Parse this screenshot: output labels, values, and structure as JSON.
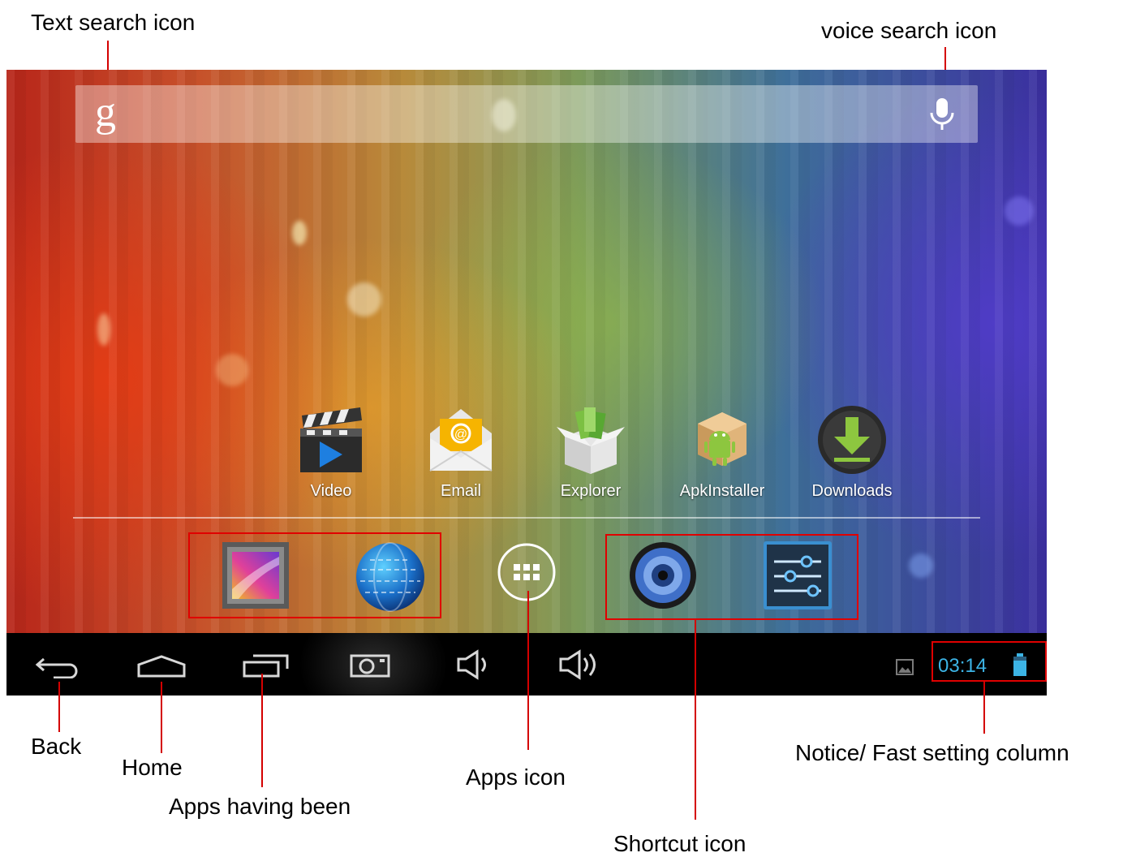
{
  "annotations": {
    "text_search": "Text search icon",
    "voice_search": "voice search icon",
    "back": "Back",
    "home": "Home",
    "recent_apps": "Apps  having  been",
    "apps": "Apps icon",
    "notice": "Notice/ Fast setting column",
    "shortcut": "Shortcut icon"
  },
  "search_bar": {
    "logo": "g"
  },
  "home_apps": [
    {
      "label": "Video",
      "icon": "video-clapper-icon"
    },
    {
      "label": "Email",
      "icon": "email-icon"
    },
    {
      "label": "Explorer",
      "icon": "explorer-box-icon"
    },
    {
      "label": "ApkInstaller",
      "icon": "apk-installer-icon"
    },
    {
      "label": "Downloads",
      "icon": "downloads-icon"
    }
  ],
  "dock": {
    "left_shortcuts": [
      "gallery-icon",
      "browser-globe-icon"
    ],
    "apps_icon": "apps-grid-icon",
    "right_shortcuts": [
      "music-speaker-icon",
      "settings-sliders-icon"
    ]
  },
  "nav_bar": {
    "buttons": [
      "back-icon",
      "home-icon",
      "recent-apps-icon",
      "screenshot-icon",
      "volume-down-icon",
      "volume-up-icon"
    ],
    "status": {
      "time": "03:14",
      "time_color": "#3cb4e6"
    }
  },
  "colors": {
    "callout_line": "#d40000",
    "highlight_box": "#e00000"
  }
}
